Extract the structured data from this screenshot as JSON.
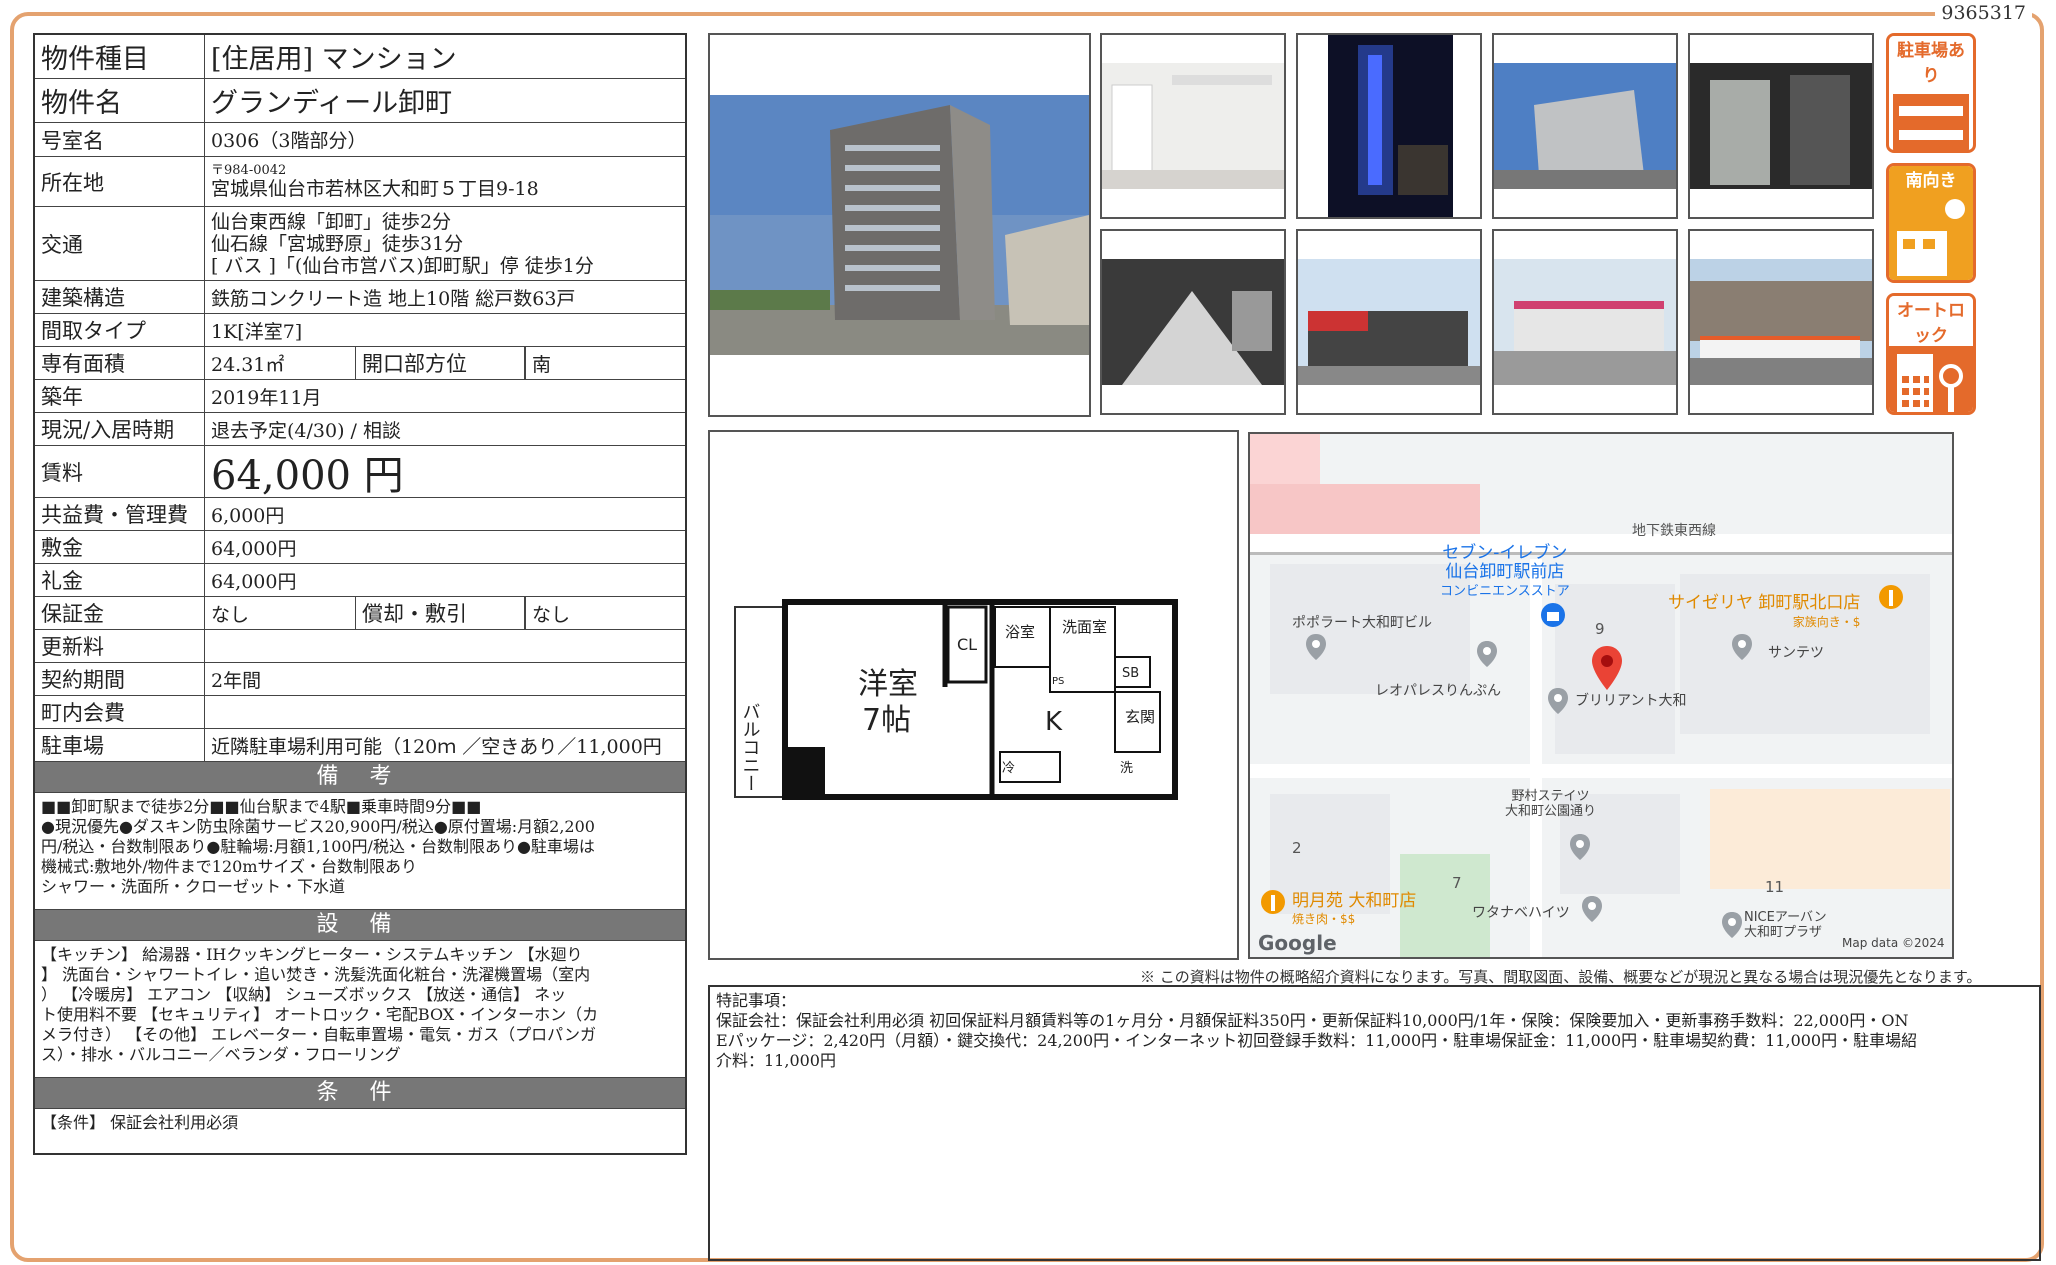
{
  "doc_id": "9365317",
  "info": {
    "type_label": "物件種目",
    "type_value": "[住居用] マンション",
    "name_label": "物件名",
    "name_value": "グランディール卸町",
    "room_label": "号室名",
    "room_value": "0306（3階部分）",
    "address_label": "所在地",
    "address_zip": "〒984-0042",
    "address_value": "宮城県仙台市若林区大和町５丁目9-18",
    "transport_label": "交通",
    "transport_lines": [
      "仙台東西線「卸町」徒歩2分",
      "仙石線「宮城野原」徒歩31分",
      "[ バス ]「(仙台市営バス)卸町駅」停 徒歩1分"
    ],
    "structure_label": "建築構造",
    "structure_value": "鉄筋コンクリート造 地上10階 総戸数63戸",
    "layout_label": "間取タイプ",
    "layout_value": "1K[洋室7]",
    "area_label": "専有面積",
    "area_value": "24.31㎡",
    "direction_label": "開口部方位",
    "direction_value": "南",
    "built_label": "築年",
    "built_value": "2019年11月",
    "status_label": "現況/入居時期",
    "status_value": "退去予定(4/30) / 相談",
    "rent_label": "賃料",
    "rent_value": "64,000 円",
    "fee_label": "共益費・管理費",
    "fee_value": "6,000円",
    "deposit_label": "敷金",
    "deposit_value": "64,000円",
    "key_money_label": "礼金",
    "key_money_value": "64,000円",
    "guarantee_label": "保証金",
    "guarantee_value": "なし",
    "amort_label": "償却・敷引",
    "amort_value": "なし",
    "renewal_label": "更新料",
    "renewal_value": "",
    "contract_label": "契約期間",
    "contract_value": "2年間",
    "town_label": "町内会費",
    "town_value": "",
    "parking_label": "駐車場",
    "parking_value": "近隣駐車場利用可能（120ｍ ／空きあり／11,000円"
  },
  "remarks_head": "備 考",
  "remarks_lines": [
    "■■卸町駅まで徒歩2分■■仙台駅まで4駅■乗車時間9分■■",
    "●現況優先●ダスキン防虫除菌サービス20,900円/税込●原付置場:月額2,200",
    "円/税込・台数制限あり●駐輪場:月額1,100円/税込・台数制限あり●駐車場は",
    "機械式:敷地外/物件まで120mサイズ・台数制限あり",
    "シャワー・洗面所・クローゼット・下水道"
  ],
  "equipment_head": "設 備",
  "equipment_lines": [
    "【キッチン】 給湯器・IHクッキングヒーター・システムキッチン 【水廻り",
    "】 洗面台・シャワートイレ・追い焚き・洗髪洗面化粧台・洗濯機置場（室内",
    "） 【冷暖房】 エアコン 【収納】 シューズボックス 【放送・通信】 ネッ",
    "ト使用料不要 【セキュリティ】 オートロック・宅配BOX・インターホン（カ",
    "メラ付き） 【その他】 エレベーター・自転車置場・電気・ガス（プロパンガ",
    "ス）・排水・バルコニー／ベランダ・フローリング"
  ],
  "conditions_head": "条 件",
  "conditions_text": "【条件】 保証会社利用必須",
  "badges": [
    "駐車場あり",
    "南向き",
    "オートロック"
  ],
  "floorplan": {
    "room": "洋室",
    "room_size": "7帖",
    "kitchen": "K",
    "closet": "CL",
    "bath": "浴室",
    "washroom": "洗面室",
    "balcony": "バルコニー",
    "entrance": "玄関",
    "sb": "SB",
    "ps": "PS",
    "ref": "冷",
    "wash": "洗"
  },
  "map": {
    "line": "地下鉄東西線",
    "seven_name": "セブン-イレブン",
    "seven_branch": "仙台卸町駅前店",
    "seven_type": "コンビニエンスストア",
    "saizeriya": "サイゼリヤ 卸町駅北口店",
    "saizeriya_type": "家族向き・$",
    "poplart": "ポポラート大和町ビル",
    "leopalace": "レオパレスりんぷん",
    "brilliant": "ブリリアント大和",
    "suntetsu": "サンテツ",
    "nomura1": "野村ステイツ",
    "nomura2": "大和町公園通り",
    "watanabe": "ワタナベハイツ",
    "meigetsu": "明月苑 大和町店",
    "meigetsu_type": "焼き肉・$$",
    "nice1": "NICEアーバン",
    "nice2": "大和町プラザ",
    "num9": "9",
    "num2": "2",
    "num7": "7",
    "num11": "11",
    "google": "Google",
    "copyright": "Map data ©2024"
  },
  "disclaimer": "※ この資料は物件の概略紹介資料になります。写真、間取図面、設備、概要などが現況と異なる場合は現況優先となります。",
  "notes_title": "特記事項：",
  "notes_lines": [
    "保証会社：保証会社利用必須 初回保証料月額賃料等の1ヶ月分・月額保証料350円・更新保証料10,000円/1年・保険：保険要加入・更新事務手数料：22,000円・ON",
    "Eパッケージ：2,420円（月額）・鍵交換代：24,200円・インターネット初回登録手数料：11,000円・駐車場保証金：11,000円・駐車場契約費：11,000円・駐車場紹",
    "介料：11,000円"
  ]
}
